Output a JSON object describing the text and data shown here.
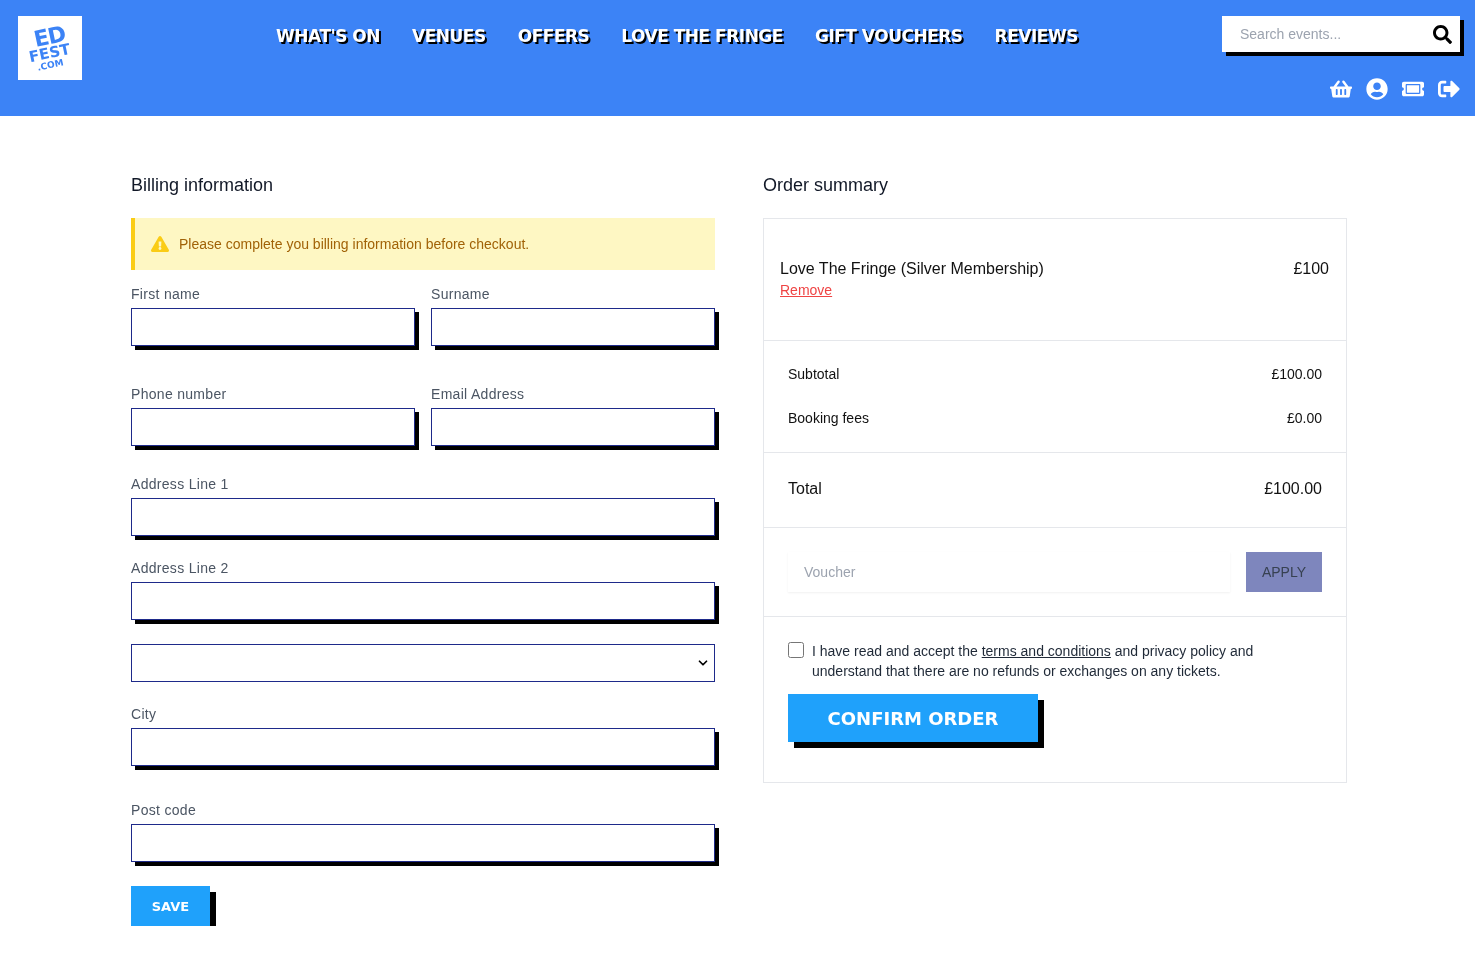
{
  "header": {
    "logo": {
      "top": "ED",
      "middle": "FEST",
      "bottom": ".COM"
    },
    "nav": [
      {
        "label": "WHAT'S ON"
      },
      {
        "label": "VENUES"
      },
      {
        "label": "OFFERS"
      },
      {
        "label": "LOVE THE FRINGE"
      },
      {
        "label": "GIFT VOUCHERS"
      },
      {
        "label": "REVIEWS"
      }
    ],
    "search": {
      "placeholder": "Search events..."
    }
  },
  "billing": {
    "title": "Billing information",
    "alert": {
      "kind": "warning",
      "text": "Please complete you billing information before checkout."
    },
    "rows": [
      [
        {
          "kind": "text",
          "label": "First name"
        },
        {
          "kind": "text",
          "label": "Surname"
        }
      ],
      [
        {
          "kind": "text",
          "label": "Phone number"
        },
        {
          "kind": "text",
          "label": "Email Address"
        }
      ],
      [
        {
          "kind": "text",
          "label": "Address Line 1"
        }
      ],
      [
        {
          "kind": "text",
          "label": "Address Line 2"
        }
      ],
      [
        {
          "kind": "select"
        }
      ],
      [
        {
          "kind": "text",
          "label": "City"
        }
      ],
      [
        {
          "kind": "text",
          "label": "Post code"
        }
      ]
    ],
    "save_button": "SAVE"
  },
  "order": {
    "title": "Order summary",
    "items": [
      {
        "name": "Love The Fringe (Silver Membership)",
        "price": "£100",
        "remove": "Remove"
      }
    ],
    "lines": [
      {
        "label": "Subtotal",
        "value": "£100.00"
      },
      {
        "label": "Booking fees",
        "value": "£0.00"
      }
    ],
    "total": {
      "label": "Total",
      "value": "£100.00"
    },
    "voucher": {
      "placeholder": "Voucher",
      "button": "APPLY"
    },
    "terms": {
      "checked": false,
      "before": "I have read and accept the ",
      "link": "terms and conditions",
      "after": " and privacy policy and understand that there are no refunds or exchanges on any tickets."
    },
    "confirm_button": "CONFIRM ORDER"
  }
}
